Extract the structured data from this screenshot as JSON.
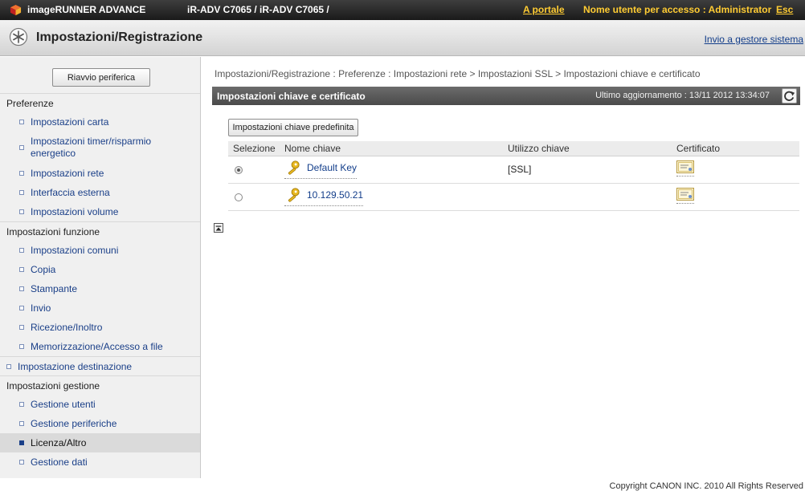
{
  "header": {
    "product": "imageRUNNER ADVANCE",
    "device": "iR-ADV C7065 / iR-ADV C7065 /",
    "portal_link": "A portale",
    "user_info": "Nome utente per accesso : Administrator",
    "logout_link": "Esc"
  },
  "title_bar": {
    "title": "Impostazioni/Registrazione",
    "send_link": "Invio a gestore sistema"
  },
  "sidebar": {
    "reboot_button": "Riavvio periferica",
    "sections": [
      {
        "label": "Preferenze",
        "items": [
          "Impostazioni carta",
          "Impostazioni timer/risparmio energetico",
          "Impostazioni rete",
          "Interfaccia esterna",
          "Impostazioni volume"
        ]
      },
      {
        "label": "Impostazioni funzione",
        "items": [
          "Impostazioni comuni",
          "Copia",
          "Stampante",
          "Invio",
          "Ricezione/Inoltro",
          "Memorizzazione/Accesso a file"
        ]
      },
      {
        "label": "Impostazione destinazione",
        "items": []
      },
      {
        "label": "Impostazioni gestione",
        "items": [
          "Gestione utenti",
          "Gestione periferiche",
          "Licenza/Altro",
          "Gestione dati"
        ]
      }
    ],
    "active_item": "Licenza/Altro"
  },
  "main": {
    "breadcrumb": "Impostazioni/Registrazione : Preferenze : Impostazioni rete > Impostazioni SSL > Impostazioni chiave e certificato",
    "section_title": "Impostazioni chiave e certificato",
    "last_update": "Ultimo aggiornamento : 13/11 2012 13:34:07",
    "default_key_button": "Impostazioni chiave predefinita",
    "table": {
      "headers": [
        "Selezione",
        "Nome chiave",
        "Utilizzo chiave",
        "Certificato"
      ],
      "rows": [
        {
          "selected": true,
          "name": "Default Key",
          "usage": "[SSL]"
        },
        {
          "selected": false,
          "name": "10.129.50.21",
          "usage": ""
        }
      ]
    }
  },
  "footer": {
    "copyright": "Copyright CANON INC. 2010 All Rights Reserved"
  },
  "colors": {
    "topbar": "#2b2b2b",
    "link": "#123d8a",
    "accent_yellow": "#ffcc33",
    "section_bar": "#5a5a5a"
  }
}
